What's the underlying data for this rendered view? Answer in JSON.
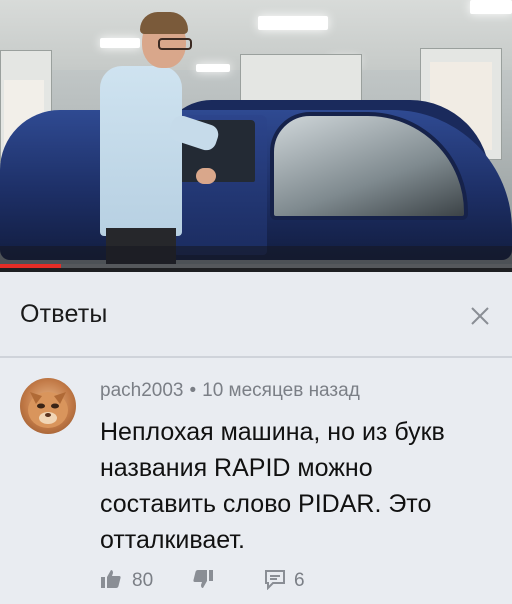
{
  "header": {
    "title": "Ответы"
  },
  "comment": {
    "author": "pach2003",
    "separator": "•",
    "time": "10 месяцев назад",
    "text": "Неплохая машина, но из букв названия RAPID можно составить слово PIDAR. Это отталкивает.",
    "likes": "80",
    "replies": "6"
  },
  "video": {
    "progress_fraction": 0.12,
    "progress_color": "#e52d27"
  },
  "icons": {
    "close": "close-icon",
    "like": "thumbs-up-icon",
    "dislike": "thumbs-down-icon",
    "reply": "reply-icon"
  }
}
